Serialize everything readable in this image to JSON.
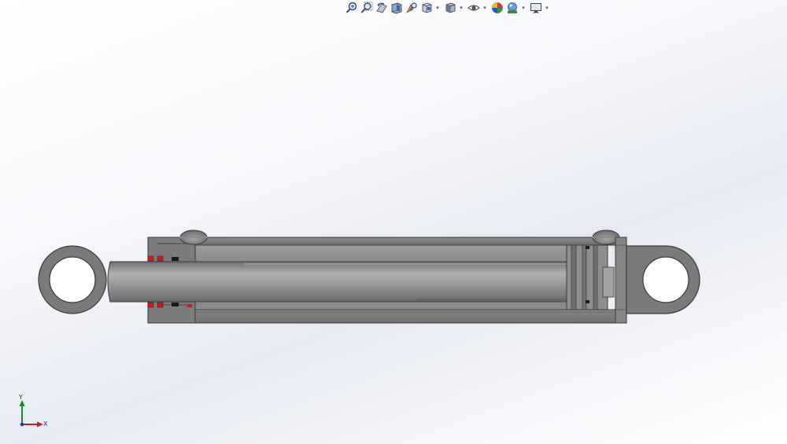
{
  "toolbar": {
    "buttons": [
      {
        "name": "zoom-to-fit",
        "icon": "zoom-fit-icon",
        "has_dropdown": false
      },
      {
        "name": "zoom-to-area",
        "icon": "zoom-area-icon",
        "has_dropdown": false
      },
      {
        "name": "previous-view",
        "icon": "previous-view-icon",
        "has_dropdown": false
      },
      {
        "name": "section-view",
        "icon": "section-view-icon",
        "has_dropdown": false
      },
      {
        "name": "dynamic-annotation-views",
        "icon": "annotation-view-icon",
        "has_dropdown": false
      },
      {
        "name": "view-orientation",
        "icon": "view-orientation-icon",
        "has_dropdown": true
      },
      {
        "name": "display-style",
        "icon": "display-style-icon",
        "has_dropdown": true
      },
      {
        "name": "hide-show-items",
        "icon": "hide-show-icon",
        "has_dropdown": true
      },
      {
        "name": "edit-appearance",
        "icon": "edit-appearance-icon",
        "has_dropdown": false
      },
      {
        "name": "apply-scene",
        "icon": "apply-scene-icon",
        "has_dropdown": true
      },
      {
        "name": "view-settings",
        "icon": "monitor-icon",
        "has_dropdown": true
      }
    ],
    "dropdown_glyph": "▾"
  },
  "triad": {
    "x_label": "X",
    "y_label": "Y",
    "x_color": "#cc2020",
    "y_color": "#1a8a2a",
    "z_color": "#2040c0"
  },
  "colors": {
    "steel": "#7d7d7d",
    "steel_light": "#9a9a9a",
    "steel_dark": "#555555",
    "edge": "#3a3a3a",
    "seal_red": "#c81e1e",
    "seal_black": "#1a1a1a"
  }
}
